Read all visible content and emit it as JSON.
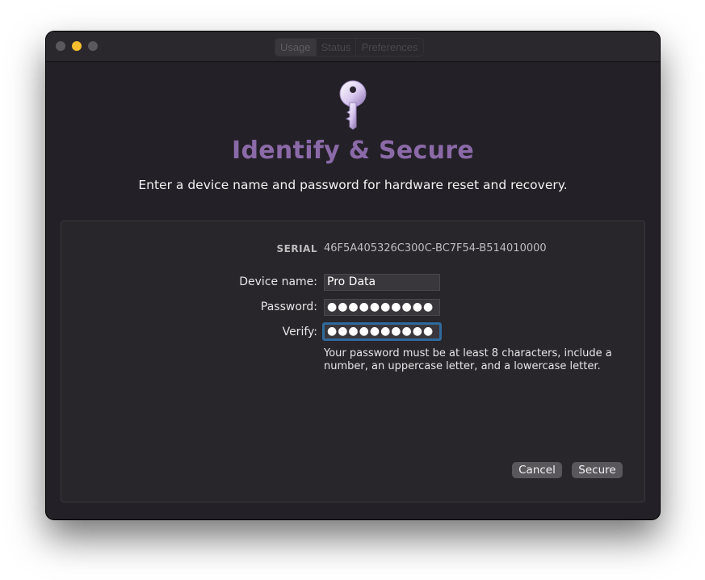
{
  "window": {
    "tabs": [
      {
        "label": "Usage",
        "active": true
      },
      {
        "label": "Status",
        "active": false
      },
      {
        "label": "Preferences",
        "active": false
      }
    ]
  },
  "header": {
    "icon": "key-icon",
    "title": "Identify & Secure",
    "subtitle": "Enter a device name and password for hardware reset and recovery."
  },
  "form": {
    "serial_label": "SERIAL",
    "serial_value": "46F5A405326C300C-BC7F54-B514010000",
    "device_name_label": "Device name:",
    "device_name_value": "Pro Data",
    "password_label": "Password:",
    "password_value": "●●●●●●●●●●",
    "verify_label": "Verify:",
    "verify_value": "●●●●●●●●●●",
    "hint": "Your password must be at least 8 characters, include a number, an uppercase letter, and a lowercase letter."
  },
  "actions": {
    "cancel_label": "Cancel",
    "secure_label": "Secure"
  },
  "colors": {
    "accent_title": "#8b6aa8",
    "focus_ring": "#2f6a9c",
    "minimize_light": "#f5be2f"
  }
}
